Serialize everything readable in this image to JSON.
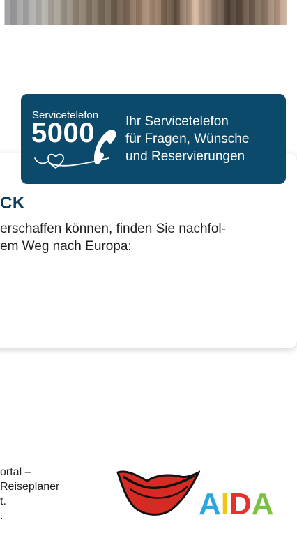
{
  "service": {
    "label": "Servicetelefon",
    "number": "5000",
    "desc_line1": "Ihr Servicetelefon",
    "desc_line2": "für Fragen, Wünsche",
    "desc_line3": "und Reservierungen"
  },
  "card": {
    "heading": "CK",
    "text_line1": "erschaffen können, finden Sie nachfol-",
    "text_line2": "em Weg nach Europa:"
  },
  "footer": {
    "line1": "ortal –",
    "line2": "Reiseplaner",
    "line3": "t.",
    "line4": "."
  },
  "logo": {
    "letters": [
      "A",
      "I",
      "D",
      "A"
    ],
    "colors": {
      "A1": "#2aa7df",
      "I": "#f4c41b",
      "D": "#e5322d",
      "A2": "#7cc242",
      "lips": "#d52b24"
    }
  },
  "colors": {
    "service_bg": "#0b4a6b",
    "heading": "#0b3a5c"
  }
}
